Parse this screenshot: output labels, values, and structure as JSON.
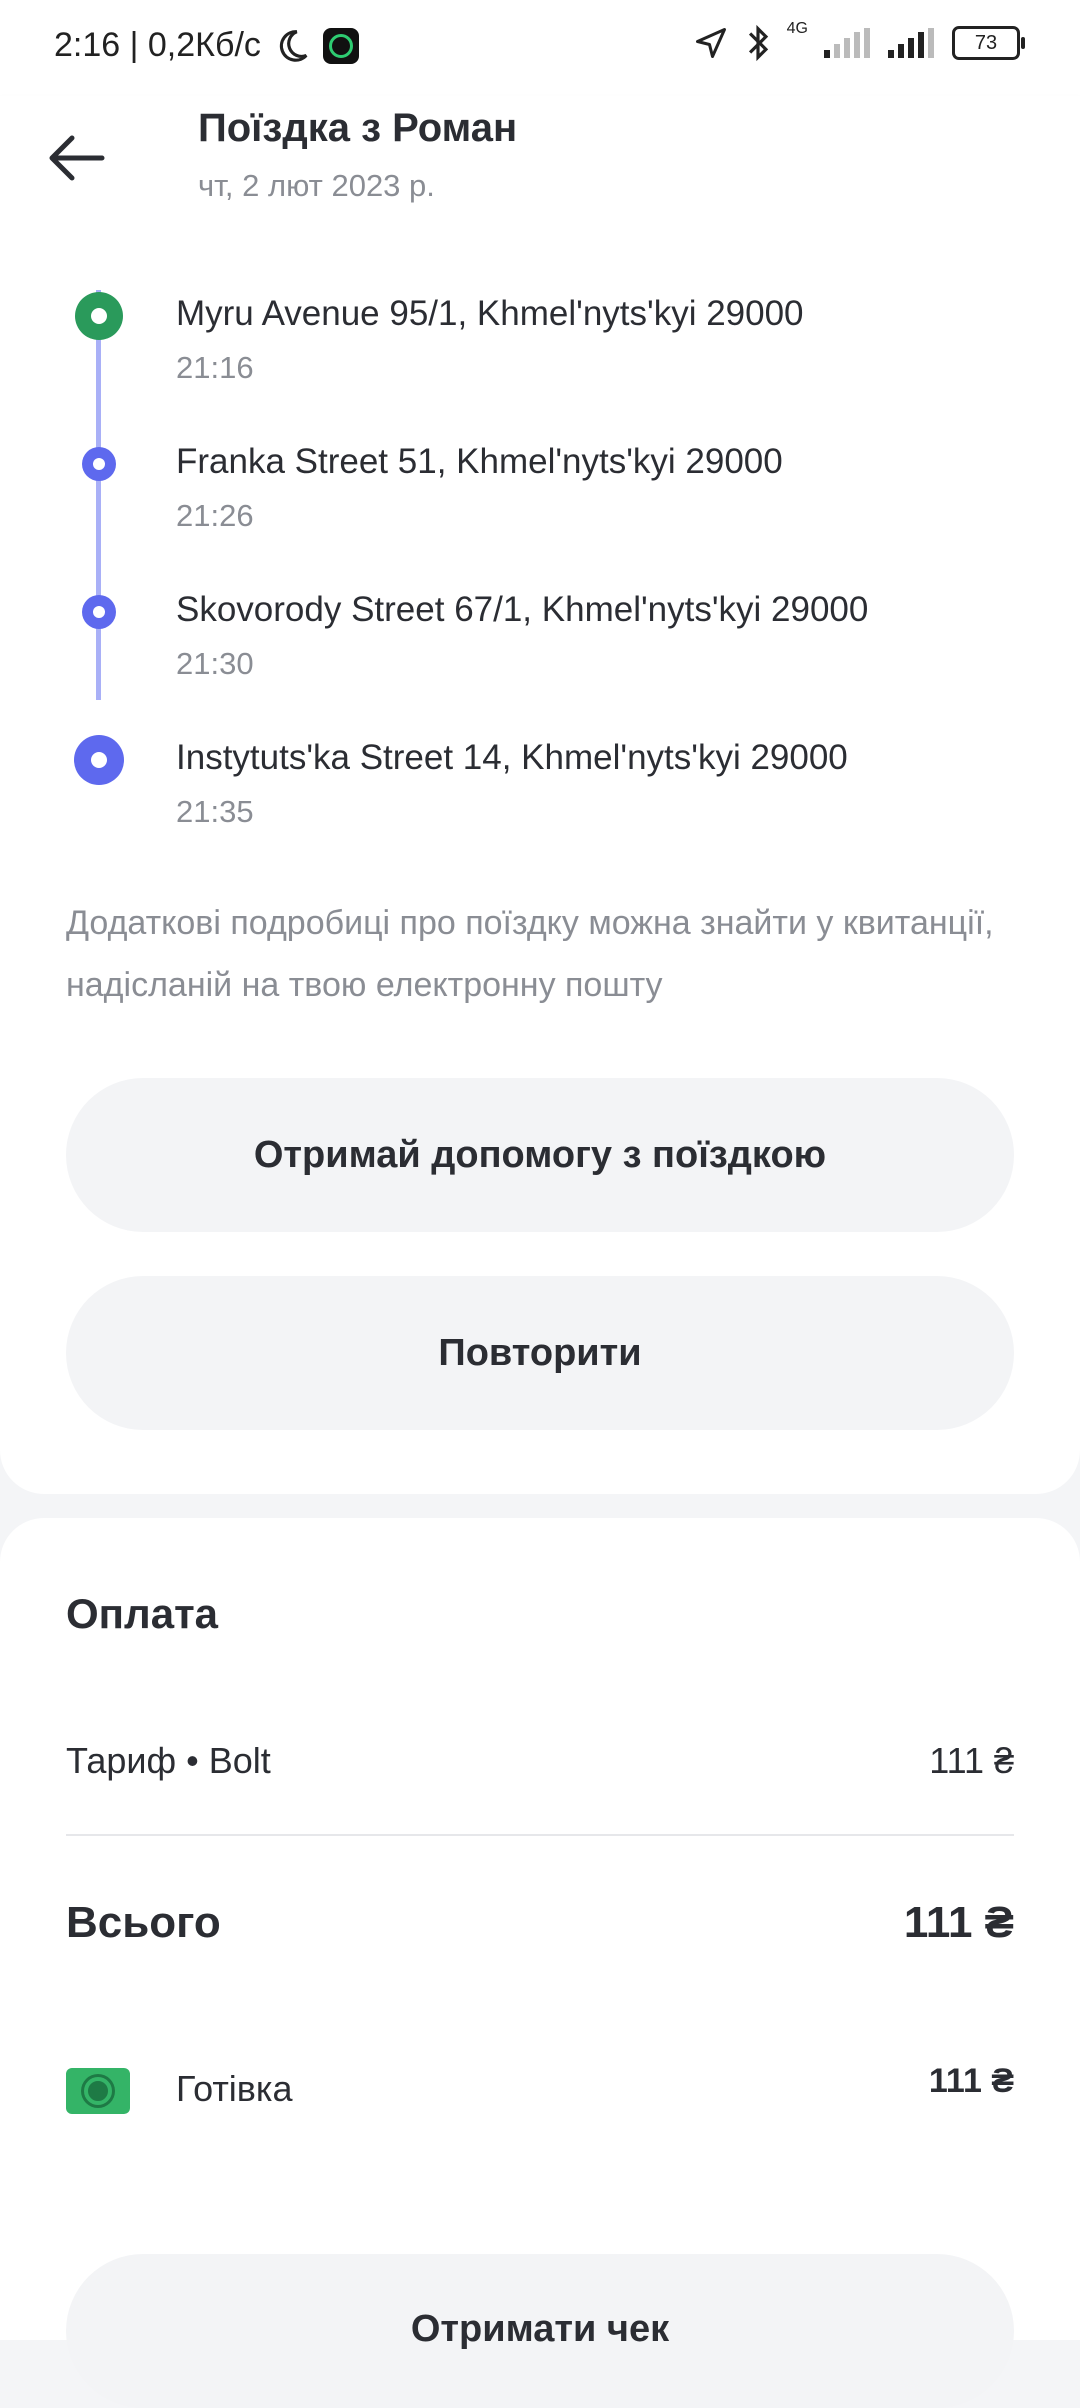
{
  "status_bar": {
    "time_speed": "2:16 | 0,2Кб/с",
    "network": "4G",
    "battery": "73"
  },
  "header": {
    "title": "Поїздка з Роман",
    "date": "чт, 2 лют 2023 р."
  },
  "route": {
    "stops": [
      {
        "address": "Myru Avenue 95/1, Khmel'nyts'kyi 29000",
        "time": "21:16"
      },
      {
        "address": "Franka Street 51, Khmel'nyts'kyi 29000",
        "time": "21:26"
      },
      {
        "address": "Skovorody Street 67/1, Khmel'nyts'kyi 29000",
        "time": "21:30"
      },
      {
        "address": "Instytuts'ka Street 14, Khmel'nyts'kyi 29000",
        "time": "21:35"
      }
    ],
    "info_text": "Додаткові подробиці про поїздку можна знайти у квитанції, надісланій на твою електронну пошту"
  },
  "actions": {
    "help_label": "Отримай допомогу з поїздкою",
    "repeat_label": "Повторити"
  },
  "payment": {
    "title": "Оплата",
    "fare_label": "Тариф • Bolt",
    "fare_value": "111 ₴",
    "total_label": "Всього",
    "total_value": "111 ₴",
    "method_label": "Готівка",
    "method_value": "111 ₴",
    "receipt_label": "Отримати чек"
  },
  "colors": {
    "start_dot": "#2a9a5b",
    "stop_dot": "#5e69ee",
    "route_line": "#a9b0f7",
    "cash_icon": "#34b467"
  }
}
